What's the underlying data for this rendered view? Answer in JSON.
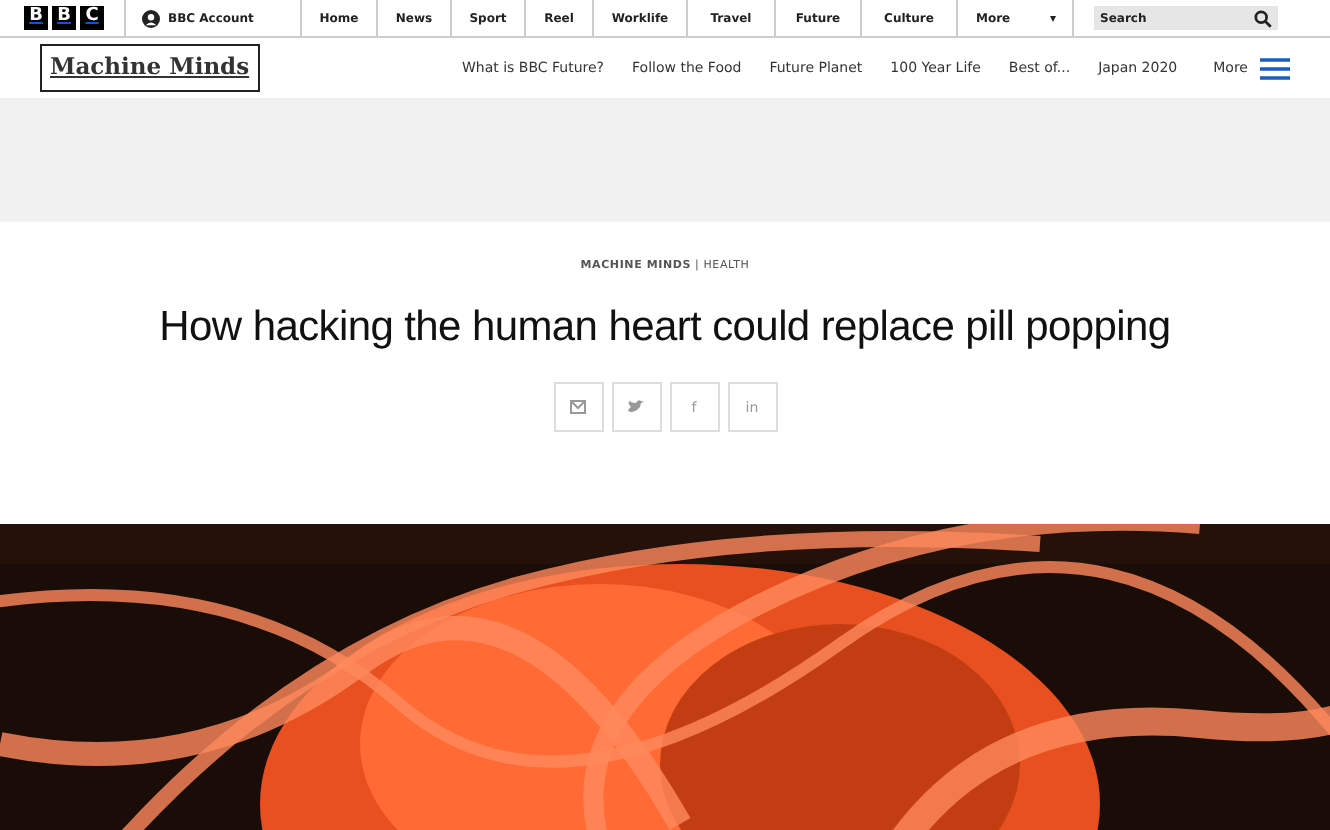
{
  "top_bar": {
    "logo_letters": [
      "B",
      "B",
      "C"
    ],
    "account": "BBC Account",
    "nav": [
      {
        "label": "Home"
      },
      {
        "label": "News"
      },
      {
        "label": "Sport"
      },
      {
        "label": "Reel"
      },
      {
        "label": "Worklife"
      },
      {
        "label": "Travel"
      },
      {
        "label": "Future"
      },
      {
        "label": "Culture"
      }
    ],
    "more": "More",
    "more_caret": "▾",
    "search": {
      "placeholder": "Search"
    }
  },
  "section_nav": {
    "brand": "Machine Minds",
    "links": [
      "What is BBC Future?",
      "Follow the Food",
      "Future Planet",
      "100 Year Life",
      "Best of...",
      "Japan 2020"
    ],
    "more": "More"
  },
  "article": {
    "series": "MACHINE MINDS",
    "separator": "|",
    "category": "HEALTH",
    "title": "How hacking the human heart could replace pill popping",
    "share": [
      {
        "kind": "mail"
      },
      {
        "kind": "bird"
      },
      {
        "kind": "letter",
        "text": "f"
      },
      {
        "kind": "letter",
        "text": "in"
      }
    ]
  }
}
